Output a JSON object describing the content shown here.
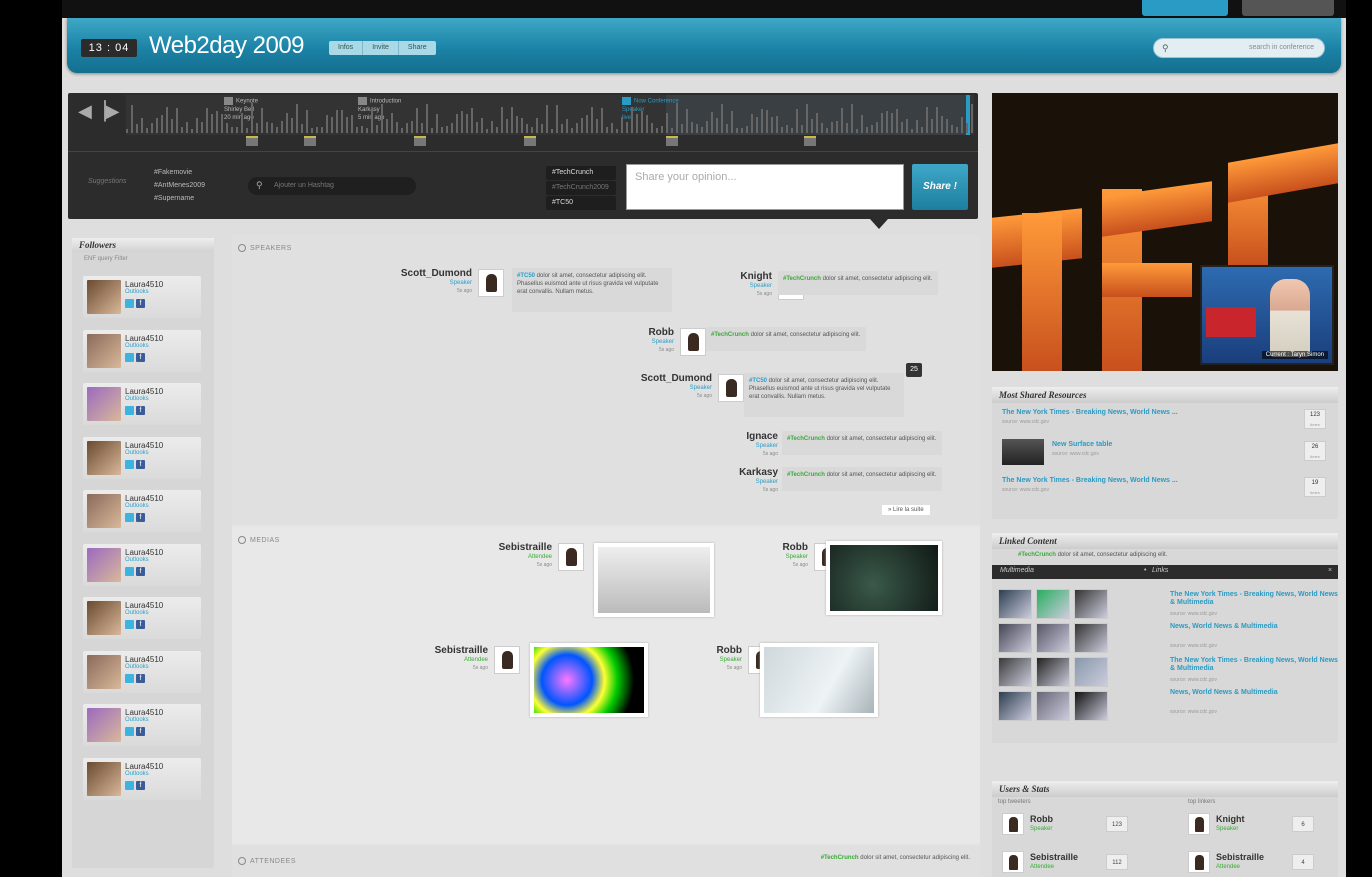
{
  "header": {
    "clock": "13 : 04",
    "title": "Web2day 2009",
    "tabs": [
      "Infos",
      "Invite",
      "Share"
    ],
    "search_placeholder": "search in conference"
  },
  "timeline": {
    "segments": [
      {
        "title": "Keynote",
        "sub1": "Shirley Bell",
        "sub2": "20 min ago"
      },
      {
        "title": "Introduction",
        "sub1": "Karkasy",
        "sub2": "5 min ago"
      },
      {
        "title": "Now Conference",
        "sub1": "Speaker",
        "sub2": "live"
      }
    ],
    "suggestions_label": "Suggestions",
    "suggestions": [
      "#Fakemovie",
      "#AntMenes2009",
      "#Supername"
    ],
    "hashtag_placeholder": "Ajouter un Hashtag",
    "tags": [
      "#TechCrunch",
      "#TechCrunch2009",
      "#TC50"
    ],
    "opinion_placeholder": "Share your opinion...",
    "share_label": "Share !"
  },
  "followers": {
    "title": "Followers",
    "filter": "ENF query Filter",
    "items": [
      {
        "name": "Laura4510",
        "role": "Outlooks"
      },
      {
        "name": "Laura4510",
        "role": "Outlooks"
      },
      {
        "name": "Laura4510",
        "role": "Outlooks"
      },
      {
        "name": "Laura4510",
        "role": "Outlooks"
      },
      {
        "name": "Laura4510",
        "role": "Outlooks"
      },
      {
        "name": "Laura4510",
        "role": "Outlooks"
      },
      {
        "name": "Laura4510",
        "role": "Outlooks"
      },
      {
        "name": "Laura4510",
        "role": "Outlooks"
      },
      {
        "name": "Laura4510",
        "role": "Outlooks"
      },
      {
        "name": "Laura4510",
        "role": "Outlooks"
      }
    ]
  },
  "speakers": {
    "title": "SPEAKERS",
    "read_more": "» Lire la suite",
    "count": "25",
    "posts": [
      {
        "name": "Scott_Dumond",
        "role": "Speaker",
        "time": "5s ago",
        "tag": "#TC50",
        "text": " dolor sit amet, consectetur adipiscing elit. Phasellus euismod ante ut risus gravida vel vulputate erat convallis. Nullam metus."
      },
      {
        "name": "Knight",
        "role": "Speaker",
        "time": "5s ago",
        "tag": "#TechCrunch",
        "text": " dolor sit amet, consectetur adipiscing elit."
      },
      {
        "name": "Robb",
        "role": "Speaker",
        "time": "5s ago",
        "tag": "#TechCrunch",
        "text": " dolor sit amet, consectetur adipiscing elit."
      },
      {
        "name": "Scott_Dumond",
        "role": "Speaker",
        "time": "5s ago",
        "tag": "#TC50",
        "text": " dolor sit amet, consectetur adipiscing elit. Phasellus euismod ante ut risus gravida vel vulputate erat convallis. Nullam metus."
      },
      {
        "name": "Ignace",
        "role": "Speaker",
        "time": "5s ago",
        "tag": "#TechCrunch",
        "text": " dolor sit amet, consectetur adipiscing elit."
      },
      {
        "name": "Karkasy",
        "role": "Speaker",
        "time": "5s ago",
        "tag": "#TechCrunch",
        "text": " dolor sit amet, consectetur adipiscing elit."
      }
    ]
  },
  "medias": {
    "title": "MEDIAS",
    "posts": [
      {
        "name": "Sebistraille",
        "role": "Attendee",
        "time": "5s ago"
      },
      {
        "name": "Robb",
        "role": "Speaker",
        "time": "5s ago"
      },
      {
        "name": "Sebistraille",
        "role": "Attendee",
        "time": "5s ago"
      },
      {
        "name": "Robb",
        "role": "Speaker",
        "time": "5s ago"
      }
    ]
  },
  "attendees": {
    "title": "ATTENDEES",
    "tag": "#TechCrunch",
    "text": " dolor sit amet, consectetur adipiscing elit."
  },
  "video": {
    "caption": "Current : Taryn Simon"
  },
  "most_shared": {
    "title": "Most Shared Resources",
    "items": [
      {
        "title": "The New York Times - Breaking News, World News ...",
        "source": "source: www.cdc.gov",
        "count": "123",
        "unit": "times"
      },
      {
        "title": "New Surface table",
        "source": "source: www.cdc.gov",
        "count": "26",
        "unit": "times"
      },
      {
        "title": "The New York Times - Breaking News, World News ...",
        "source": "source: www.cdc.gov",
        "count": "19",
        "unit": "times"
      }
    ]
  },
  "linked": {
    "title": "Linked Content",
    "tag": "#TechCrunch",
    "text": " dolor sit amet, consectetur adipiscing elit.",
    "tab_multimedia": "Multimedia",
    "tab_links": "Links",
    "links": [
      {
        "title": "The New York Times - Breaking News, World News & Multimedia",
        "source": "source: www.cdc.gov"
      },
      {
        "title": "News, World News & Multimedia",
        "source": "source: www.cdc.gov"
      },
      {
        "title": "The New York Times - Breaking News, World News & Multimedia",
        "source": "source: www.cdc.gov"
      },
      {
        "title": "News, World News & Multimedia",
        "source": "source: www.cdc.gov"
      }
    ]
  },
  "stats": {
    "title": "Users & Stats",
    "col1": "top tweeters",
    "col2": "top linkers",
    "users": [
      {
        "name": "Robb",
        "role": "Speaker",
        "n": "123"
      },
      {
        "name": "Knight",
        "role": "Speaker",
        "n": "6"
      },
      {
        "name": "Sebistraille",
        "role": "Attendee",
        "n": "112"
      },
      {
        "name": "Sebistraille",
        "role": "Attendee",
        "n": "4"
      }
    ]
  }
}
